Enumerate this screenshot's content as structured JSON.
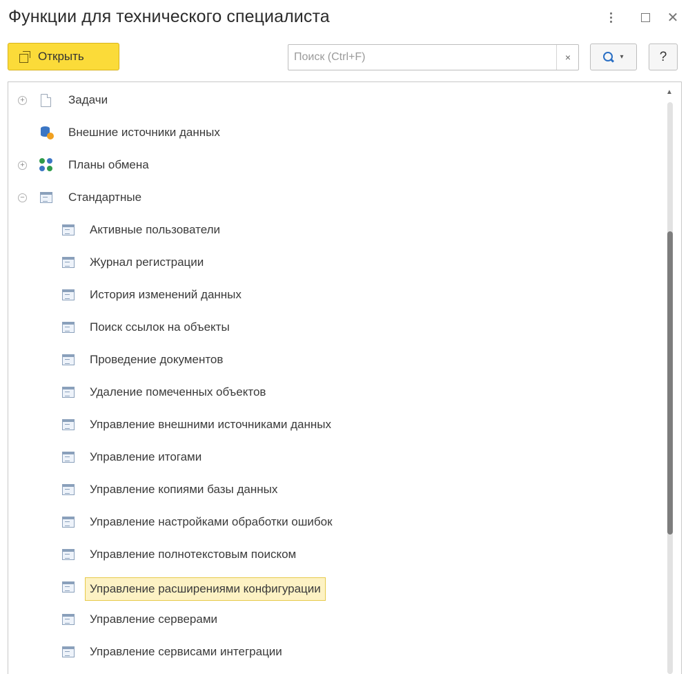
{
  "window": {
    "title": "Функции для технического специалиста",
    "controls": {
      "close_glyph": "✕"
    }
  },
  "toolbar": {
    "open_label": "Открыть",
    "search": {
      "placeholder": "Поиск (Ctrl+F)",
      "value": "",
      "clear_glyph": "×"
    },
    "search_button_caret": "▾",
    "help_label": "?"
  },
  "tree": {
    "expander_plus": "+",
    "expander_minus": "−",
    "items": [
      {
        "label": "Задачи",
        "icon": "document-icon",
        "expandable": true,
        "expanded": false
      },
      {
        "label": "Внешние источники данных",
        "icon": "database-icon",
        "expandable": false
      },
      {
        "label": "Планы обмена",
        "icon": "exchange-icon",
        "expandable": true,
        "expanded": false
      },
      {
        "label": "Стандартные",
        "icon": "form-icon",
        "expandable": true,
        "expanded": true
      },
      {
        "label": "Активные пользователи",
        "icon": "form-icon"
      },
      {
        "label": "Журнал регистрации",
        "icon": "form-icon"
      },
      {
        "label": "История изменений данных",
        "icon": "form-icon"
      },
      {
        "label": "Поиск ссылок на объекты",
        "icon": "form-icon"
      },
      {
        "label": "Проведение документов",
        "icon": "form-icon"
      },
      {
        "label": "Удаление помеченных объектов",
        "icon": "form-icon"
      },
      {
        "label": "Управление внешними источниками данных",
        "icon": "form-icon"
      },
      {
        "label": "Управление итогами",
        "icon": "form-icon"
      },
      {
        "label": "Управление копиями базы данных",
        "icon": "form-icon"
      },
      {
        "label": "Управление настройками обработки ошибок",
        "icon": "form-icon"
      },
      {
        "label": "Управление полнотекстовым поиском",
        "icon": "form-icon"
      },
      {
        "label": "Управление расширениями конфигурации",
        "icon": "form-icon",
        "selected": true
      },
      {
        "label": "Управление серверами",
        "icon": "form-icon"
      },
      {
        "label": "Управление сервисами интеграции",
        "icon": "form-icon"
      }
    ]
  },
  "scrollbar": {
    "up_glyph": "▲",
    "position_fraction": 0.48,
    "visible_fraction": 0.53
  },
  "colors": {
    "open_button": "#fbdb39",
    "selection_fill": "#fdf2c4",
    "selection_border": "#e6c94a",
    "search_icon": "#2a6fc4"
  }
}
